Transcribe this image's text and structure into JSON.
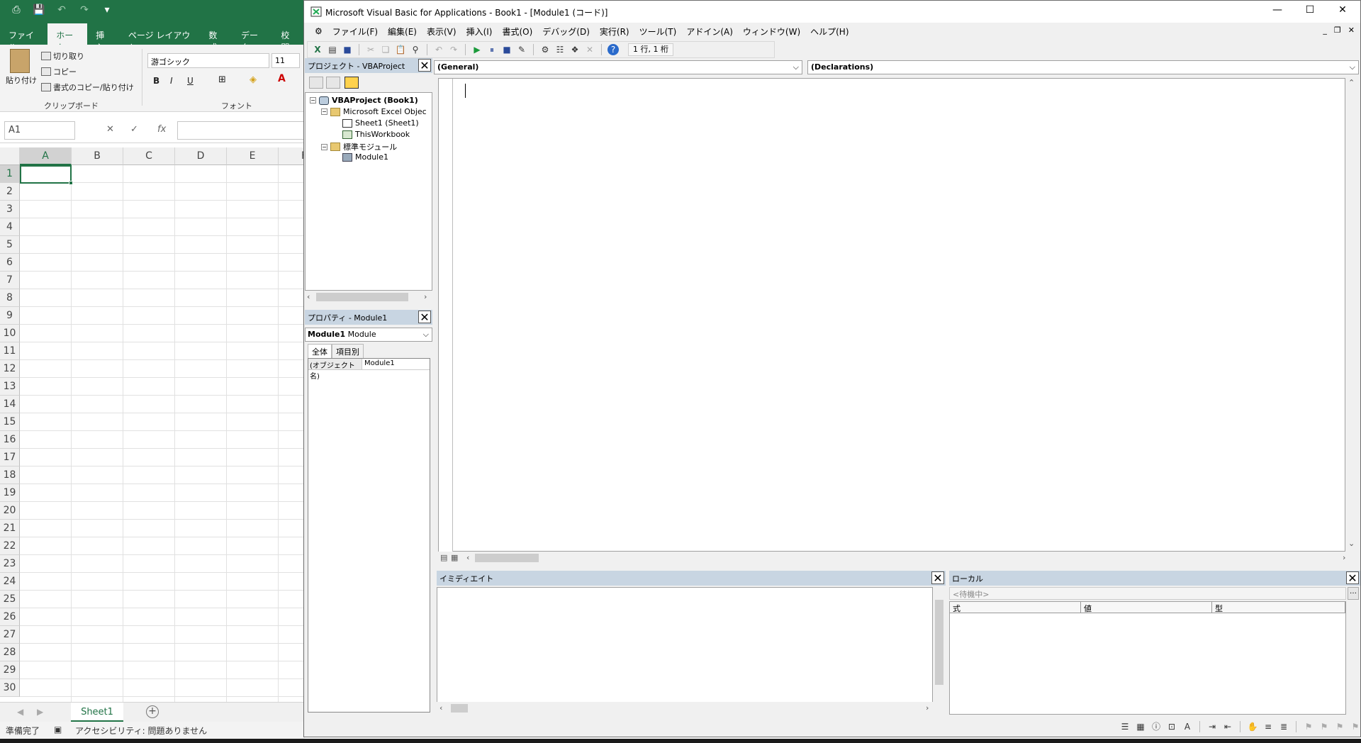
{
  "excel": {
    "tabs": [
      "ファイル",
      "ホーム",
      "挿入",
      "ページ レイアウト",
      "数式",
      "データ",
      "校閲"
    ],
    "active_tab": "ホーム",
    "clipboard": {
      "paste": "貼り付け",
      "cut": "切り取り",
      "copy": "コピー",
      "format_painter": "書式のコピー/貼り付け",
      "group_label": "クリップボード"
    },
    "font": {
      "name": "游ゴシック",
      "size": "11",
      "group_label": "フォント",
      "bold": "B",
      "italic": "I",
      "underline": "U"
    },
    "name_box": "A1",
    "columns": [
      "A",
      "B",
      "C",
      "D",
      "E",
      "F"
    ],
    "rows": [
      "1",
      "2",
      "3",
      "4",
      "5",
      "6",
      "7",
      "8",
      "9",
      "10",
      "11",
      "12",
      "13",
      "14",
      "15",
      "16",
      "17",
      "18",
      "19",
      "20",
      "21",
      "22",
      "23",
      "24",
      "25",
      "26",
      "27",
      "28",
      "29",
      "30"
    ],
    "sheet_tab": "Sheet1",
    "status_ready": "準備完了",
    "status_accessibility": "アクセシビリティ: 問題ありません"
  },
  "vbe": {
    "title": "Microsoft Visual Basic for Applications - Book1 - [Module1 (コード)]",
    "menu": [
      "ファイル(F)",
      "編集(E)",
      "表示(V)",
      "挿入(I)",
      "書式(O)",
      "デバッグ(D)",
      "実行(R)",
      "ツール(T)",
      "アドイン(A)",
      "ウィンドウ(W)",
      "ヘルプ(H)"
    ],
    "cursor_position": "1 行, 1 桁",
    "project": {
      "title": "プロジェクト - VBAProject",
      "root": "VBAProject (Book1)",
      "excel_objects": "Microsoft Excel Objec",
      "sheet1": "Sheet1 (Sheet1)",
      "this_workbook": "ThisWorkbook",
      "std_modules": "標準モジュール",
      "module1": "Module1"
    },
    "properties": {
      "title": "プロパティ - Module1",
      "object_name": "Module1",
      "object_type": "Module",
      "tab_all": "全体",
      "tab_category": "項目別",
      "row_key": "(オブジェクト名)",
      "row_value": "Module1"
    },
    "code": {
      "object_combo": "(General)",
      "proc_combo": "(Declarations)"
    },
    "immediate": {
      "title": "イミディエイト"
    },
    "locals": {
      "title": "ローカル",
      "status": "<待機中>",
      "col_expr": "式",
      "col_value": "値",
      "col_type": "型"
    }
  }
}
